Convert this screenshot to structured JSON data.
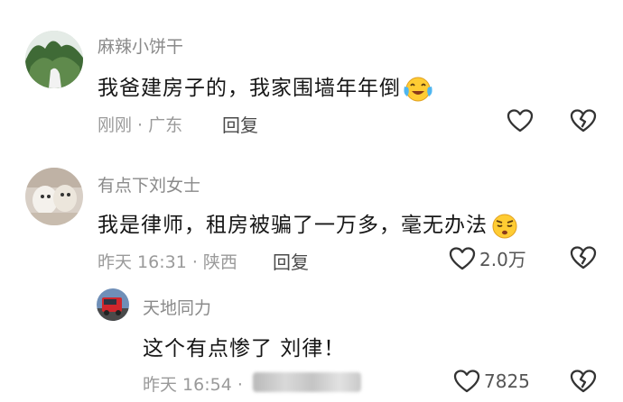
{
  "comments": [
    {
      "username": "麻辣小饼干",
      "text": "我爸建房子的，我家围墙年年倒",
      "emoji": "crying-laughing-emoji",
      "meta": "刚刚 · 广东",
      "reply_label": "回复",
      "like_count": ""
    },
    {
      "username": "有点下刘女士",
      "text": "我是律师，租房被骗了一万多，毫无办法",
      "emoji": "sighing-face-emoji",
      "meta": "昨天 16:31 · 陕西",
      "reply_label": "回复",
      "like_count": "2.0万"
    }
  ],
  "reply": {
    "username": "天地同力",
    "text": "这个有点惨了 刘律！",
    "meta": "昨天 16:54 ·",
    "like_count": "7825"
  },
  "colors": {
    "username": "#8a8a8a",
    "text": "#161616",
    "meta": "#9a9a9a",
    "icon": "#333333"
  }
}
